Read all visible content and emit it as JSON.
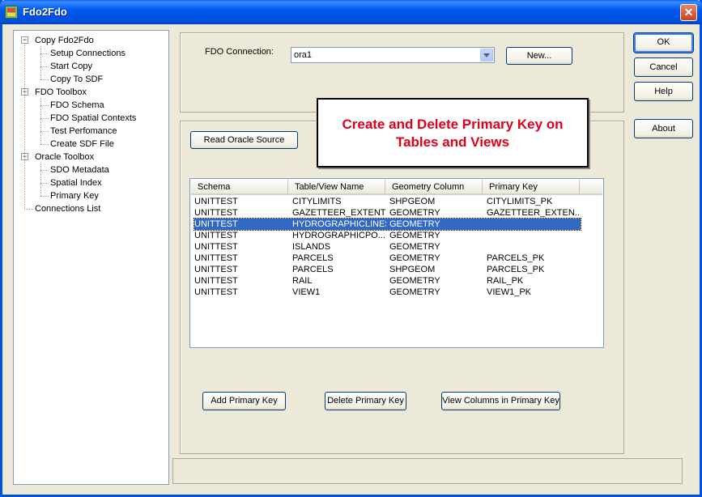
{
  "window": {
    "title": "Fdo2Fdo",
    "close_glyph": "✕"
  },
  "tree": [
    {
      "label": "Copy Fdo2Fdo",
      "level": 0,
      "expanded": true
    },
    {
      "label": "Setup Connections",
      "level": 1
    },
    {
      "label": "Start Copy",
      "level": 1
    },
    {
      "label": "Copy To SDF",
      "level": 1
    },
    {
      "label": "FDO Toolbox",
      "level": 0,
      "expanded": true
    },
    {
      "label": "FDO Schema",
      "level": 1
    },
    {
      "label": "FDO Spatial Contexts",
      "level": 1
    },
    {
      "label": "Test Perfomance",
      "level": 1
    },
    {
      "label": "Create SDF File",
      "level": 1
    },
    {
      "label": "Oracle Toolbox",
      "level": 0,
      "expanded": true
    },
    {
      "label": "SDO Metadata",
      "level": 1
    },
    {
      "label": "Spatial Index",
      "level": 1
    },
    {
      "label": "Primary Key",
      "level": 1
    },
    {
      "label": "Connections List",
      "level": 0
    }
  ],
  "connection": {
    "label": "FDO Connection:",
    "value": "ora1",
    "new_button": "New..."
  },
  "callout": {
    "line1": "Create and Delete Primary Key on",
    "line2": "Tables and Views"
  },
  "read_button": "Read Oracle Source",
  "table": {
    "columns": [
      "Schema",
      "Table/View Name",
      "Geometry Column",
      "Primary Key"
    ],
    "rows": [
      [
        "UNITTEST",
        "CITYLIMITS",
        "SHPGEOM",
        "CITYLIMITS_PK"
      ],
      [
        "UNITTEST",
        "GAZETTEER_EXTENT",
        "GEOMETRY",
        "GAZETTEER_EXTEN..."
      ],
      [
        "UNITTEST",
        "HYDROGRAPHICLINES",
        "GEOMETRY",
        ""
      ],
      [
        "UNITTEST",
        "HYDROGRAPHICPO...",
        "GEOMETRY",
        ""
      ],
      [
        "UNITTEST",
        "ISLANDS",
        "GEOMETRY",
        ""
      ],
      [
        "UNITTEST",
        "PARCELS",
        "GEOMETRY",
        "PARCELS_PK"
      ],
      [
        "UNITTEST",
        "PARCELS",
        "SHPGEOM",
        "PARCELS_PK"
      ],
      [
        "UNITTEST",
        "RAIL",
        "GEOMETRY",
        "RAIL_PK"
      ],
      [
        "UNITTEST",
        "VIEW1",
        "GEOMETRY",
        "VIEW1_PK"
      ]
    ],
    "selected_row": 2
  },
  "actions": {
    "add": "Add Primary Key",
    "delete": "Delete Primary Key",
    "view_columns": "View Columns in Primary Key"
  },
  "dialog_buttons": {
    "ok": "OK",
    "cancel": "Cancel",
    "help": "Help",
    "about": "About"
  },
  "colors": {
    "titlebar": "#0058ee",
    "selection": "#316ac5",
    "callout_text": "#e0001a"
  }
}
